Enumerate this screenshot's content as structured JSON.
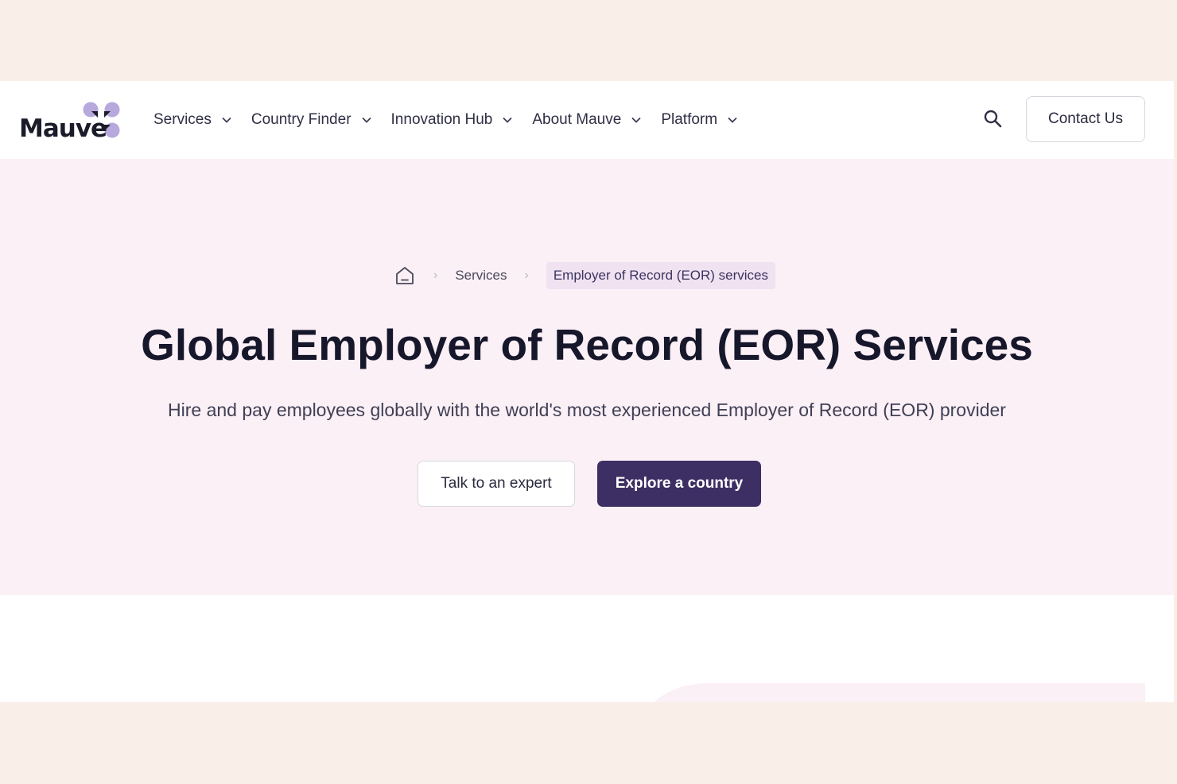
{
  "colors": {
    "outer_background": "#faeee9",
    "hero_background": "#fbf0f6",
    "primary": "#3d2f63",
    "logo_accent": "#b8a9dc"
  },
  "header": {
    "logo_text": "Mauve",
    "nav": [
      {
        "label": "Services",
        "icon": "chevron-down-icon"
      },
      {
        "label": "Country Finder",
        "icon": "chevron-down-icon"
      },
      {
        "label": "Innovation Hub",
        "icon": "chevron-down-icon"
      },
      {
        "label": "About Mauve",
        "icon": "chevron-down-icon"
      },
      {
        "label": "Platform",
        "icon": "chevron-down-icon"
      }
    ],
    "search_icon": "search-icon",
    "contact_label": "Contact Us"
  },
  "breadcrumb": {
    "home_icon": "home-icon",
    "items": [
      {
        "label": "Services"
      },
      {
        "label": "Employer of Record (EOR) services"
      }
    ]
  },
  "hero": {
    "title": "Global Employer of Record (EOR) Services",
    "subtitle": "Hire and pay employees globally with the world's most experienced Employer of Record (EOR) provider",
    "secondary_cta": "Talk to an expert",
    "primary_cta": "Explore a country"
  }
}
